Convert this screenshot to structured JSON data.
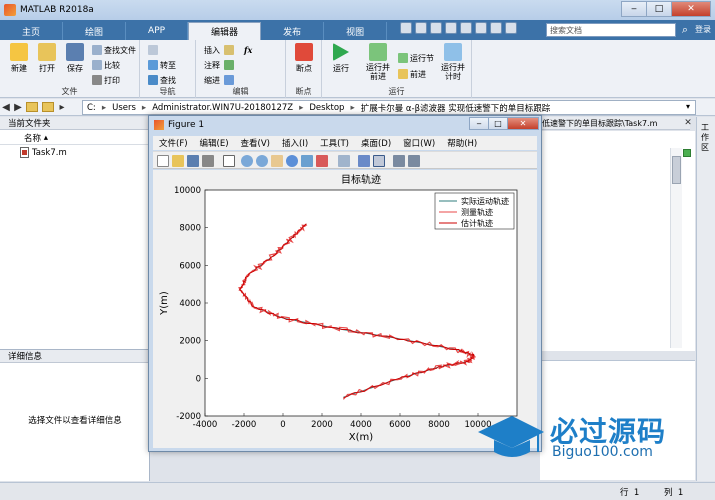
{
  "window": {
    "title": "MATLAB R2018a"
  },
  "tabs": [
    "主页",
    "绘图",
    "APP",
    "编辑器",
    "发布",
    "视图"
  ],
  "active_tab_index": 3,
  "search": {
    "placeholder": "搜索文档",
    "login": "登录"
  },
  "toolstrip": {
    "file": {
      "label": "文件",
      "new": "新建",
      "open": "打开",
      "save": "保存",
      "find_files": "查找文件",
      "compare": "比较",
      "print": "打印"
    },
    "navigate": {
      "label": "导航",
      "goto": "转至",
      "find": "查找"
    },
    "edit": {
      "label": "编辑",
      "insert": "插入",
      "comment": "注释",
      "indent": "缩进",
      "fx": "fx"
    },
    "breakpoints": {
      "label": "断点",
      "breakpoints": "断点"
    },
    "run": {
      "label": "运行",
      "run": "运行",
      "run_advance": "运行并\n前进",
      "run_section": "运行节",
      "advance": "前进",
      "run_time": "运行并\n计时"
    }
  },
  "address": {
    "segments": [
      "C:",
      "Users",
      "Administrator.WIN7U-20180127Z",
      "Desktop",
      "扩展卡尔曼 α-β滤波器 实现低速警下的单目标跟踪"
    ]
  },
  "current_folder": {
    "title": "当前文件夹",
    "column": "名称",
    "files": [
      "Task7.m"
    ]
  },
  "details": {
    "title": "详细信息",
    "message": "选择文件以查看详细信息"
  },
  "editor": {
    "tab_text": "低速警下的单目标跟踪\\Task7.m"
  },
  "right_rail": {
    "label": "工作区"
  },
  "status": {
    "row_label": "行",
    "row": "1",
    "col_label": "列",
    "col": "1"
  },
  "figure": {
    "title": "Figure 1",
    "menus": [
      "文件(F)",
      "编辑(E)",
      "查看(V)",
      "插入(I)",
      "工具(T)",
      "桌面(D)",
      "窗口(W)",
      "帮助(H)"
    ]
  },
  "chart_data": {
    "type": "line",
    "title": "目标轨迹",
    "xlabel": "X(m)",
    "ylabel": "Y(m)",
    "xlim": [
      -4000,
      12000
    ],
    "ylim": [
      -2000,
      10000
    ],
    "xticks": [
      -4000,
      -2000,
      0,
      2000,
      4000,
      6000,
      8000,
      10000
    ],
    "yticks": [
      -2000,
      0,
      2000,
      4000,
      6000,
      8000,
      10000
    ],
    "legend_position": "top-right",
    "series": [
      {
        "name": "实际运动轨迹",
        "color": "#2f7d7d",
        "x": [
          3100,
          6000,
          8000,
          9500,
          9800,
          9000,
          6000,
          3000,
          0,
          -1500,
          -2200,
          -1800,
          -500,
          500,
          1200
        ],
        "y": [
          -1000,
          0,
          600,
          900,
          1200,
          1500,
          2100,
          2600,
          3200,
          3800,
          4700,
          5500,
          6500,
          7500,
          8200
        ]
      },
      {
        "name": "测量轨迹",
        "color": "#e84a4a",
        "x": [
          3100,
          6000,
          8000,
          9500,
          9800,
          9000,
          6000,
          3000,
          0,
          -1500,
          -2200,
          -1800,
          -500,
          500,
          1200
        ],
        "y": [
          -1000,
          0,
          600,
          900,
          1200,
          1500,
          2100,
          2600,
          3200,
          3800,
          4700,
          5500,
          6500,
          7500,
          8200
        ]
      },
      {
        "name": "估计轨迹",
        "color": "#cc0000",
        "x": [
          3100,
          6000,
          8000,
          9500,
          9800,
          9000,
          6000,
          3000,
          0,
          -1500,
          -2200,
          -1800,
          -500,
          500,
          1200
        ],
        "y": [
          -1000,
          0,
          600,
          900,
          1200,
          1500,
          2100,
          2600,
          3200,
          3800,
          4700,
          5500,
          6500,
          7500,
          8200
        ]
      }
    ]
  },
  "watermark": {
    "title": "必过源码",
    "url": "Biguo100.com"
  }
}
